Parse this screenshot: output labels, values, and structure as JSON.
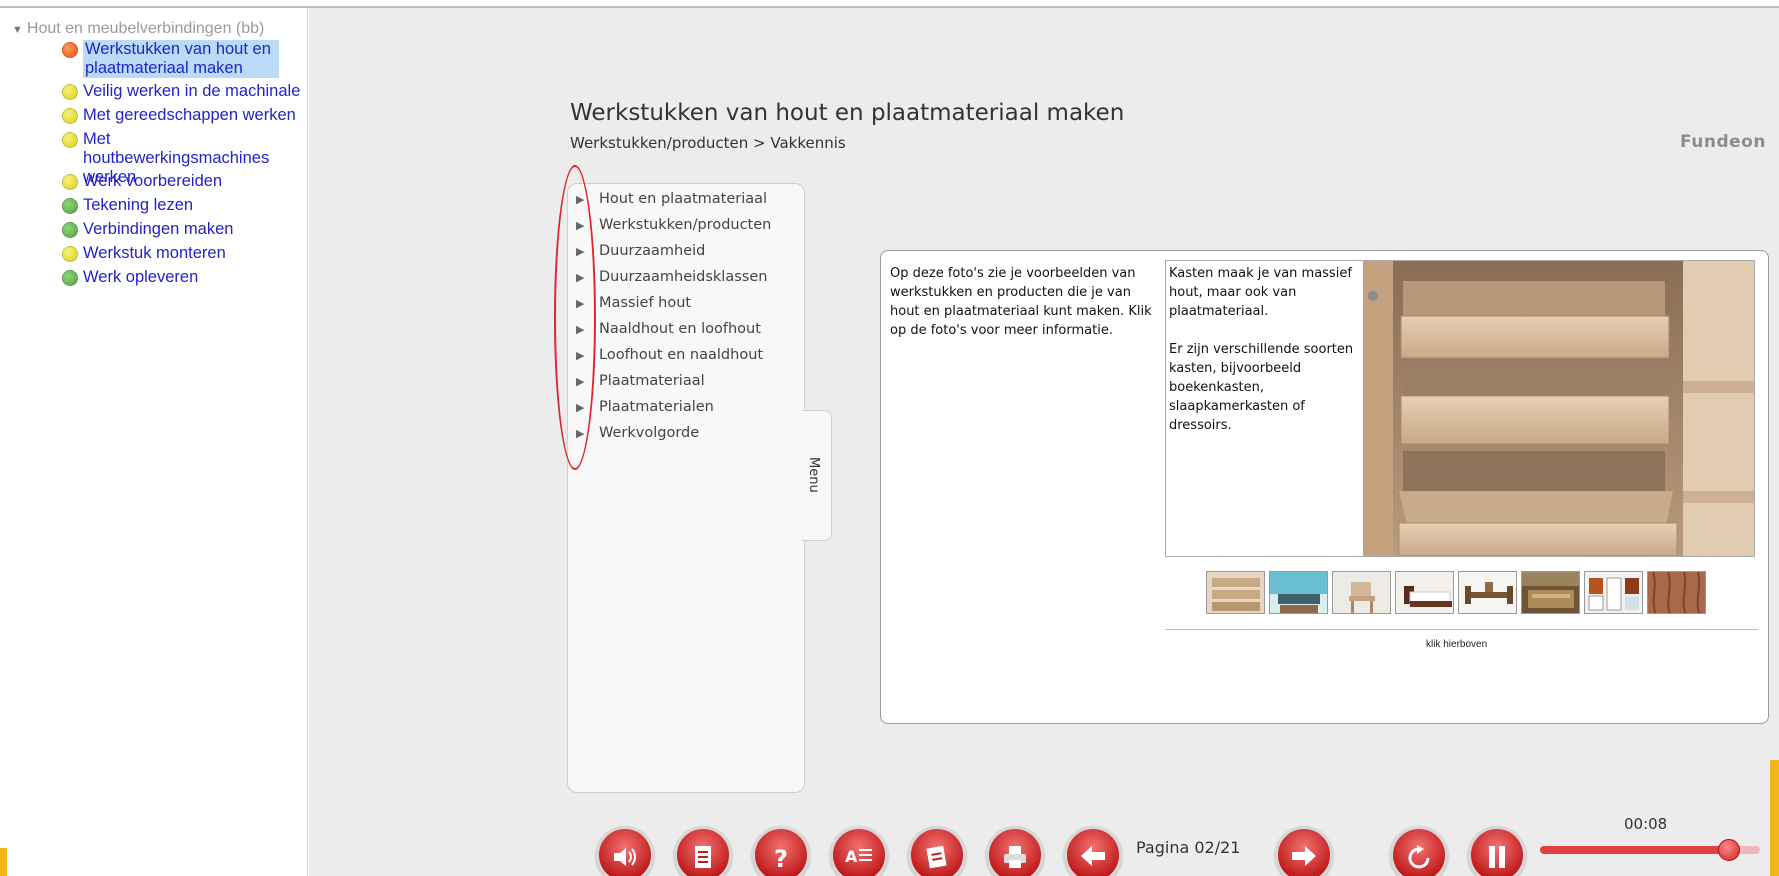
{
  "tree": {
    "root_label": "Hout en meubelverbindingen (bb)",
    "items": [
      {
        "label": "Werkstukken van hout en plaatmateriaal maken",
        "status": "orange",
        "selected": true
      },
      {
        "label": "Veilig werken in de machinale",
        "status": "yellow"
      },
      {
        "label": "Met gereedschappen werken",
        "status": "yellow"
      },
      {
        "label": "Met houtbewerkingsmachines werken",
        "status": "yellow"
      },
      {
        "label": "Werk voorbereiden",
        "status": "yellow"
      },
      {
        "label": "Tekening lezen",
        "status": "green"
      },
      {
        "label": "Verbindingen maken",
        "status": "green"
      },
      {
        "label": "Werkstuk monteren",
        "status": "yellow"
      },
      {
        "label": "Werk opleveren",
        "status": "green"
      }
    ]
  },
  "header": {
    "title": "Werkstukken van hout en plaatmateriaal maken",
    "breadcrumb": "Werkstukken/producten > Vakkennis",
    "brand": "Fundeon"
  },
  "menu": {
    "tab_label": "Menu",
    "items": [
      "Hout en plaatmateriaal",
      "Werkstukken/producten",
      "Duurzaamheid",
      "Duurzaamheidsklassen",
      "Massief hout",
      "Naaldhout en loofhout",
      "Loofhout en naaldhout",
      "Plaatmateriaal",
      "Plaatmaterialen",
      "Werkvolgorde"
    ]
  },
  "content": {
    "intro": "Op deze foto's zie je voorbeelden van werkstukken en producten die je van hout en plaatmateriaal kunt maken. Klik op de foto's voor meer informatie.",
    "description_1": "Kasten maak je van massief hout, maar ook van plaatmateriaal.",
    "description_2": "Er zijn verschillende soorten kasten, bijvoorbeeld boekenkasten, slaapkamerkasten of dressoirs.",
    "thumbnail_caption": "klik hierboven",
    "thumbnail_count": 8
  },
  "player": {
    "page_label": "Pagina 02/21",
    "time": "00:08",
    "progress": 0.86,
    "buttons": [
      "speaker-icon",
      "document-icon",
      "help-icon",
      "text-icon",
      "notes-icon",
      "print-icon",
      "previous-icon",
      "next-icon",
      "replay-icon",
      "pause-icon"
    ]
  },
  "colors": {
    "accent_red": "#c11d1d",
    "link_blue": "#2323c8",
    "annotation_red": "#e0262a"
  }
}
